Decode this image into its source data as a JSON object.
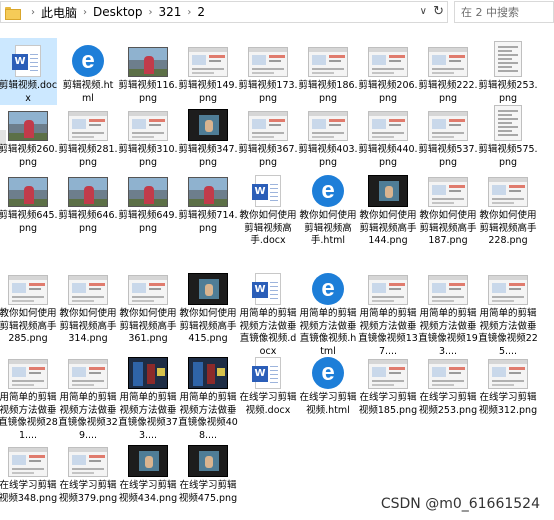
{
  "address_bar": {
    "crumbs": [
      "此电脑",
      "Desktop",
      "321",
      "2"
    ],
    "separator": "›"
  },
  "search": {
    "placeholder": "在 2 中搜索",
    "icon": "search-icon"
  },
  "files": [
    {
      "name": "剪辑视频.docx",
      "type": "docx",
      "selected": true
    },
    {
      "name": "剪辑视频.html",
      "type": "html"
    },
    {
      "name": "剪辑视频116.png",
      "type": "photo"
    },
    {
      "name": "剪辑视频149.png",
      "type": "shot"
    },
    {
      "name": "剪辑视频173.png",
      "type": "shot"
    },
    {
      "name": "剪辑视频186.png",
      "type": "shot"
    },
    {
      "name": "剪辑视频206.png",
      "type": "shot"
    },
    {
      "name": "剪辑视频222.png",
      "type": "shot"
    },
    {
      "name": "剪辑视频253.png",
      "type": "tall"
    },
    {
      "name": "剪辑视频260.png",
      "type": "photo"
    },
    {
      "name": "剪辑视频281.png",
      "type": "shot"
    },
    {
      "name": "剪辑视频310.png",
      "type": "shot"
    },
    {
      "name": "剪辑视频347.png",
      "type": "dark"
    },
    {
      "name": "剪辑视频367.png",
      "type": "shot"
    },
    {
      "name": "剪辑视频403.png",
      "type": "shot"
    },
    {
      "name": "剪辑视频440.png",
      "type": "shot"
    },
    {
      "name": "剪辑视频537.png",
      "type": "shot"
    },
    {
      "name": "剪辑视频575.png",
      "type": "tall"
    },
    {
      "name": "剪辑视频645.png",
      "type": "photo"
    },
    {
      "name": "剪辑视频646.png",
      "type": "photo"
    },
    {
      "name": "剪辑视频649.png",
      "type": "photo"
    },
    {
      "name": "剪辑视频714.png",
      "type": "photo"
    },
    {
      "name": "教你如何使用剪辑视频高手.docx",
      "type": "docx"
    },
    {
      "name": "教你如何使用剪辑视频高手.html",
      "type": "html"
    },
    {
      "name": "教你如何使用剪辑视频高手144.png",
      "type": "dark"
    },
    {
      "name": "教你如何使用剪辑视频高手187.png",
      "type": "shot"
    },
    {
      "name": "教你如何使用剪辑视频高手228.png",
      "type": "shot"
    },
    {
      "name": "教你如何使用剪辑视频高手285.png",
      "type": "shot"
    },
    {
      "name": "教你如何使用剪辑视频高手314.png",
      "type": "shot"
    },
    {
      "name": "教你如何使用剪辑视频高手361.png",
      "type": "shot"
    },
    {
      "name": "教你如何使用剪辑视频高手415.png",
      "type": "dark"
    },
    {
      "name": "用简单的剪辑视频方法做垂直镜像视频.docx",
      "type": "docx"
    },
    {
      "name": "用简单的剪辑视频方法做垂直镜像视频.html",
      "type": "html"
    },
    {
      "name": "用简单的剪辑视频方法做垂直镜像视频137....",
      "type": "shot"
    },
    {
      "name": "用简单的剪辑视频方法做垂直镜像视频193....",
      "type": "shot"
    },
    {
      "name": "用简单的剪辑视频方法做垂直镜像视频225....",
      "type": "shot"
    },
    {
      "name": "用简单的剪辑视频方法做垂直镜像视频281....",
      "type": "shot"
    },
    {
      "name": "用简单的剪辑视频方法做垂直镜像视频329....",
      "type": "shot"
    },
    {
      "name": "用简单的剪辑视频方法做垂直镜像视频373....",
      "type": "blue"
    },
    {
      "name": "用简单的剪辑视频方法做垂直镜像视频408....",
      "type": "blue"
    },
    {
      "name": "在线学习剪辑视频.docx",
      "type": "docx"
    },
    {
      "name": "在线学习剪辑视频.html",
      "type": "html"
    },
    {
      "name": "在线学习剪辑视频185.png",
      "type": "shot"
    },
    {
      "name": "在线学习剪辑视频253.png",
      "type": "shot"
    },
    {
      "name": "在线学习剪辑视频312.png",
      "type": "shot"
    },
    {
      "name": "在线学习剪辑视频348.png",
      "type": "shot"
    },
    {
      "name": "在线学习剪辑视频379.png",
      "type": "shot"
    },
    {
      "name": "在线学习剪辑视频434.png",
      "type": "dark"
    },
    {
      "name": "在线学习剪辑视频475.png",
      "type": "dark"
    }
  ],
  "watermark": "CSDN @m0_61661524",
  "colors": {
    "selection": "#cce8ff",
    "word_blue": "#2b5eb8",
    "edge_blue": "#1d7ed8"
  }
}
